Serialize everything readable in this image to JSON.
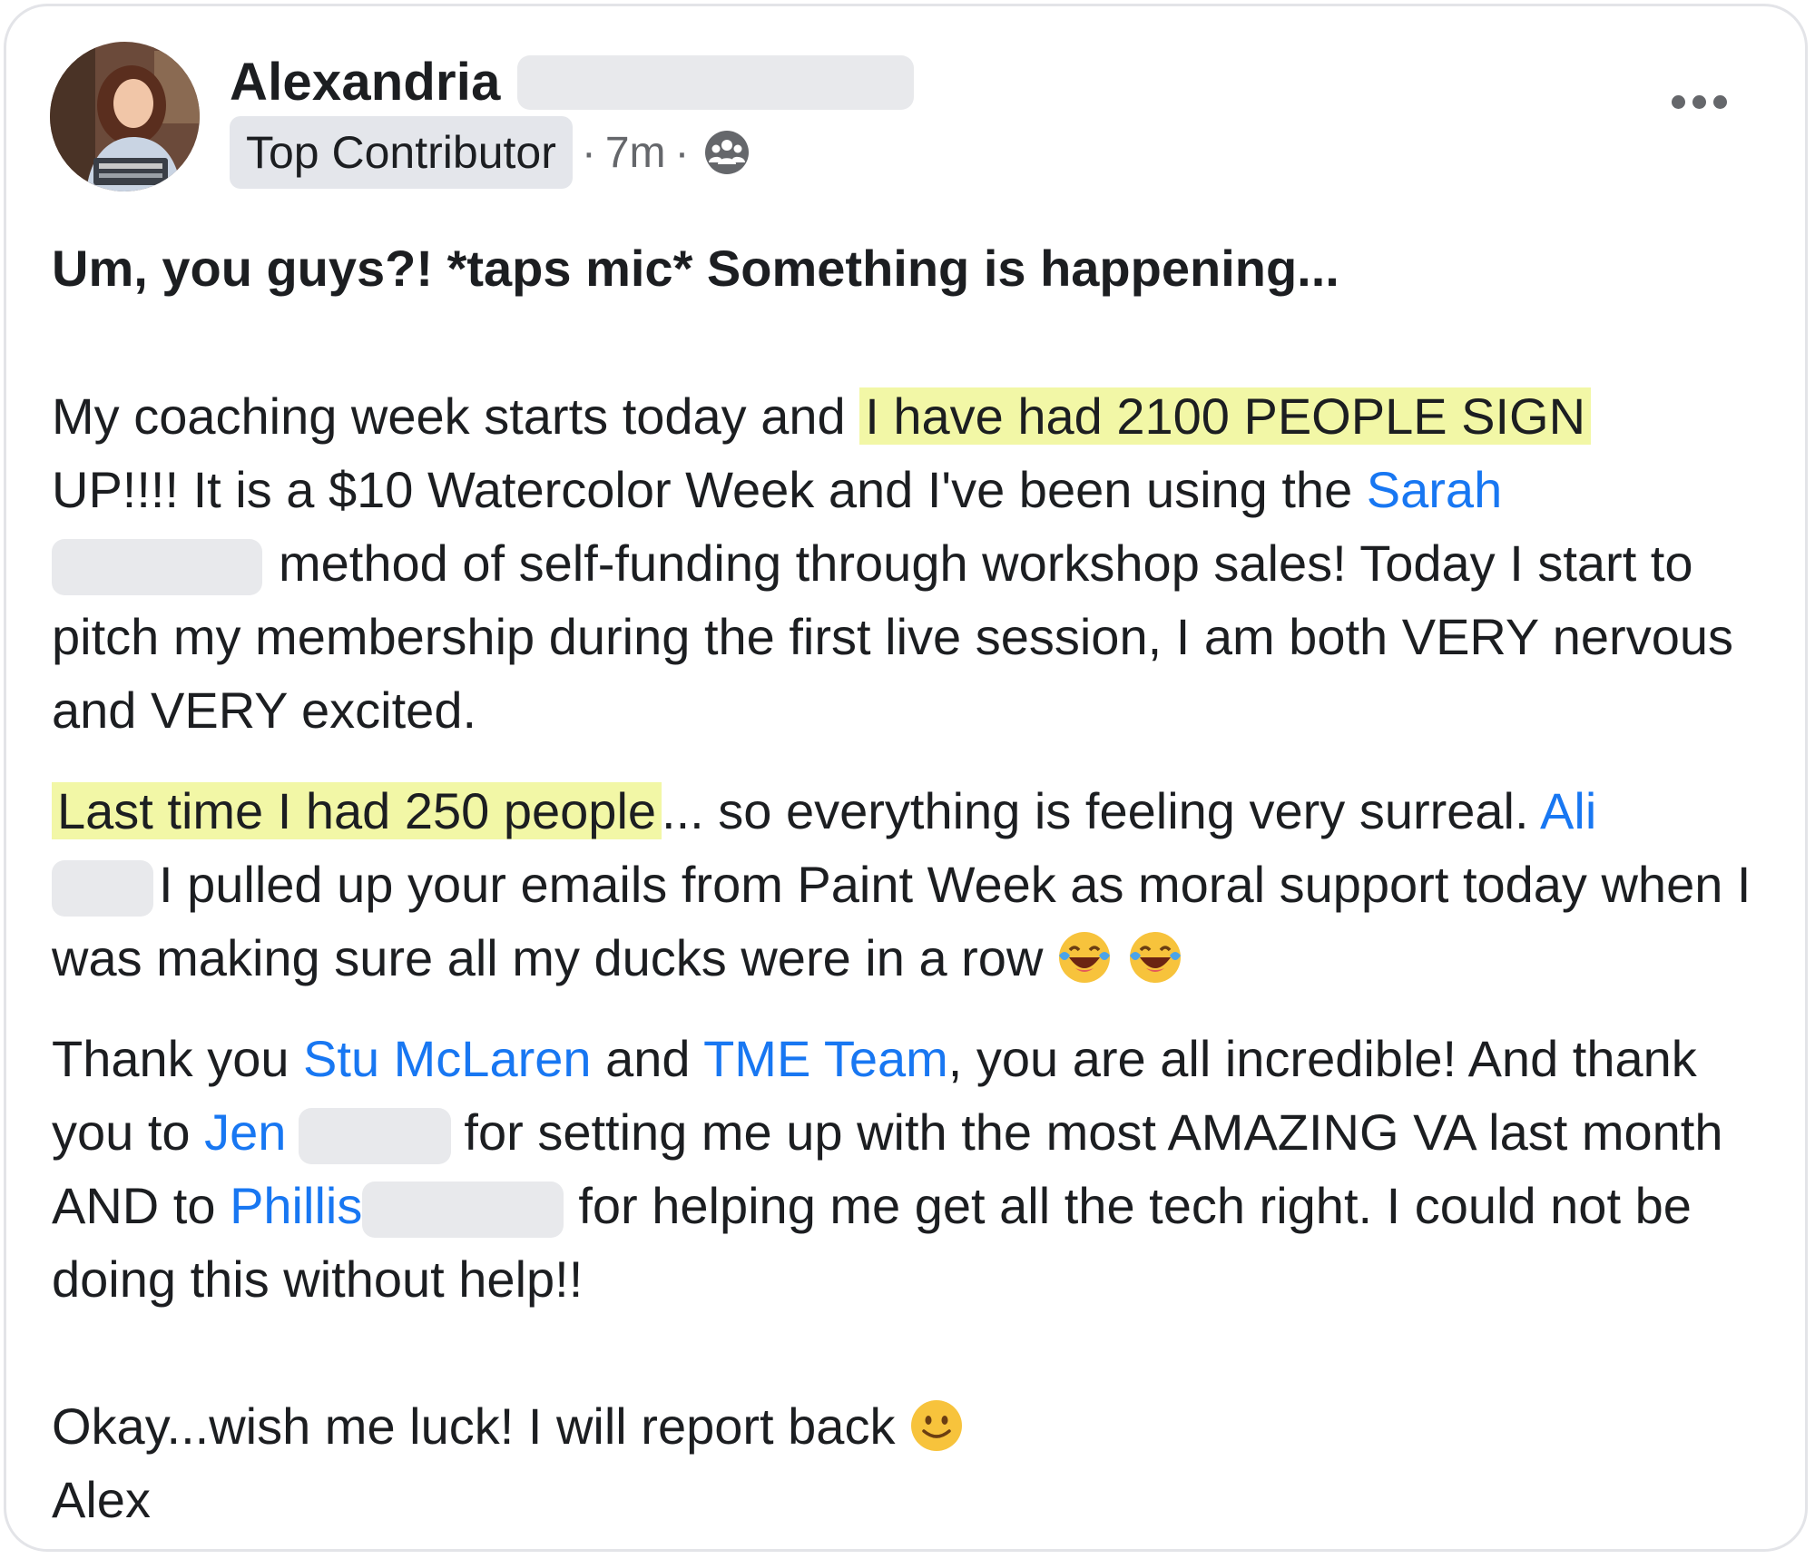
{
  "post": {
    "author_name": "Alexandria",
    "badge": "Top Contributor",
    "time": "7m",
    "icons": {
      "avatar": "profile-photo",
      "audience": "group-icon",
      "more": "more-dots-icon",
      "laugh": "tears-of-joy-emoji",
      "smile": "smile-emoji"
    },
    "headline": "Um, you guys?! *taps mic* Something is happening...",
    "p1": {
      "t1": "My coaching week starts today and ",
      "h1": "I have had 2100 PEOPLE SIGN",
      "t2": "UP!!!! It is a $10 Watercolor Week and I've been using the ",
      "link1": "Sarah",
      "t3": "method of self-funding through workshop sales! Today I start to pitch my membership during the first live session, I am both VERY nervous and VERY excited."
    },
    "p2": {
      "h1": "Last time I had 250 people",
      "t1": "... so everything is feeling very surreal. ",
      "link1": "Ali",
      "t2": "I pulled up your emails from Paint Week as moral support today when I was making sure all my ducks were in a row"
    },
    "p3": {
      "t1": "Thank you ",
      "link1": "Stu McLaren",
      "t2": " and ",
      "link2": "TME Team",
      "t3": ", you are all incredible! And thank you to ",
      "link3": "Jen",
      "t4": "for setting me up with the most AMAZING VA last month AND to ",
      "link4": "Phillis",
      "t5": "for helping me get all the tech right. I could not be doing this without help!!"
    },
    "p4": {
      "t1": "Okay...wish me luck! I will report back",
      "sign": "Alex"
    }
  }
}
